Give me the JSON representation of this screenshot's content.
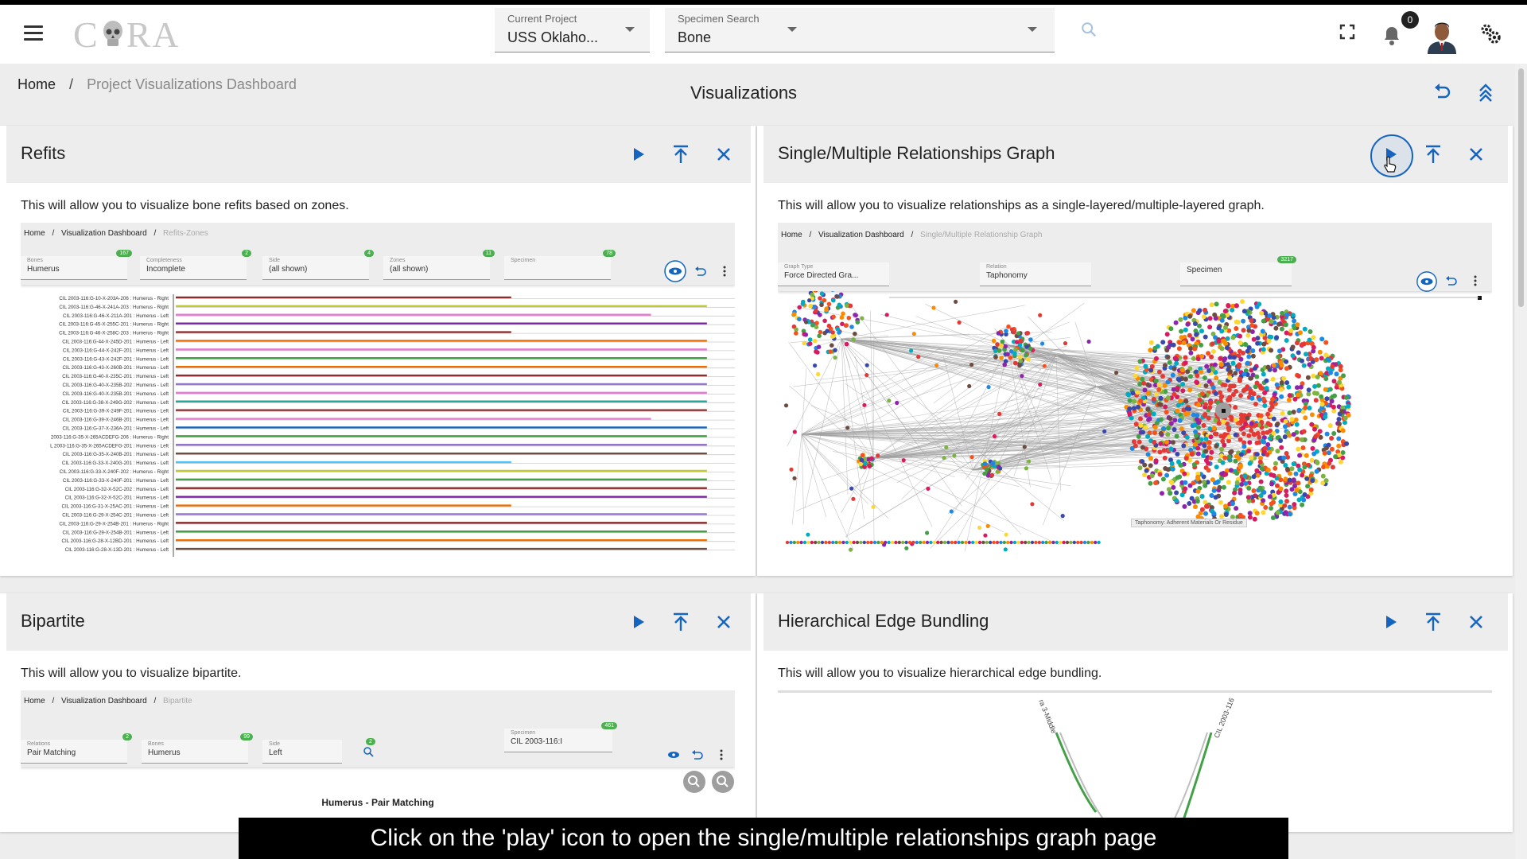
{
  "app": {
    "logo_text": "CORA",
    "current_project_label": "Current Project",
    "current_project_value": "USS Oklaho...",
    "specimen_search_label": "Specimen Search",
    "specimen_search_value": "Bone",
    "notifications_count": "0"
  },
  "breadcrumb": {
    "home": "Home",
    "separator": "/",
    "current": "Project Visualizations Dashboard"
  },
  "page_title": "Visualizations",
  "cards": {
    "refits": {
      "title": "Refits",
      "description": "This will allow you to visualize bone refits based on zones.",
      "preview": {
        "bc_home": "Home",
        "bc_sep": "/",
        "bc_dash": "Visualization Dashboard",
        "bc_current": "Refits-Zones",
        "fields": [
          {
            "label": "Bones",
            "value": "Humerus",
            "badge": "167"
          },
          {
            "label": "Completeness",
            "value": "Incomplete",
            "badge": "2"
          },
          {
            "label": "Side",
            "value": "(all shown)",
            "badge": "4"
          },
          {
            "label": "Zones",
            "value": "(all shown)",
            "badge": "11"
          },
          {
            "label": "Specimen",
            "value": "",
            "badge": "78"
          }
        ]
      }
    },
    "graph": {
      "title": "Single/Multiple Relationships Graph",
      "description": "This will allow you to visualize relationships as a single-layered/multiple-layered graph.",
      "preview": {
        "bc_home": "Home",
        "bc_sep": "/",
        "bc_dash": "Visualization Dashboard",
        "bc_current": "Single/Multiple Relationship Graph",
        "fields": [
          {
            "label": "Graph Type",
            "value": "Force Directed Gra...",
            "badge": ""
          },
          {
            "label": "Relation",
            "value": "Taphonomy",
            "badge": ""
          },
          {
            "label": "",
            "value": "Specimen",
            "badge": "3217"
          }
        ],
        "tooltip": "Taphonomy: Adherent Materials Or Residue"
      }
    },
    "bipartite": {
      "title": "Bipartite",
      "description": "This will allow you to visualize bipartite.",
      "preview": {
        "bc_home": "Home",
        "bc_sep": "/",
        "bc_dash": "Visualization Dashboard",
        "bc_current": "Bipartite",
        "fields": [
          {
            "label": "Relations",
            "value": "Pair Matching",
            "badge": "2"
          },
          {
            "label": "Bones",
            "value": "Humerus",
            "badge": "99"
          },
          {
            "label": "Side",
            "value": "Left",
            "badge": ""
          },
          {
            "label": "Specimen",
            "value": "CIL 2003-116:I",
            "badge": "461"
          }
        ],
        "filter_badge": "2",
        "chart_title": "Humerus - Pair Matching"
      }
    },
    "heb": {
      "title": "Hierarchical Edge Bundling",
      "description": "This will allow you to visualize hierarchical edge bundling.",
      "preview": {
        "label_left": "ra 3-Middle",
        "label_right": "CIL 2003-116"
      }
    }
  },
  "refit_rows": [
    "CIL 2003-116:G-10-X-203A-206 : Humerus - Right",
    "CIL 2003-116:G-46-X-241A-203 : Humerus - Right",
    "CIL 2003-116:G-46-X-211A-201 : Humerus - Left",
    "CIL 2003-116:G-45-X-255C-201 : Humerus - Right",
    "CIL 2003-116:G-46-X-258C-203 : Humerus - Right",
    "CIL 2003-116:G-44-X-245D-201 : Humerus - Left",
    "CIL 2003-116:G-44-X-242F-201 : Humerus - Left",
    "CIL 2003-116:G-43-X-242F-201 : Humerus - Left",
    "CIL 2003-116:G-43-X-260B-201 : Humerus - Left",
    "CIL 2003-116:G-40-X-235C-201 : Humerus - Left",
    "CIL 2003-116:G-40-X-235B-202 : Humerus - Left",
    "CIL 2003-116:G-40-X-235B-201 : Humerus - Left",
    "CIL 2003-116:G-38-X-249G-202 : Humerus - Left",
    "CIL 2003-116:G-39-X-249F-201 : Humerus - Left",
    "CIL 2003-116:G-39-X-246B-201 : Humerus - Left",
    "CIL 2003-116:G-37-X-236A-201 : Humerus - Left",
    "2003-116:G-35-X-265ACDEFG-206 : Humerus - Right",
    "L 2003-116:G-35-X-265ACDEFG-201 : Humerus - Left",
    "CIL 2003-116:G-35-X-240B-201 : Humerus - Left",
    "CIL 2003-116:G-33-X-240G-201 : Humerus - Left",
    "CIL 2003-116:G-33-X-240F-202 : Humerus - Right",
    "CIL 2003-116:G-33-X-240F-201 : Humerus - Left",
    "CIL 2003-116:G-32-X-52C-202 : Humerus - Left",
    "CIL 2003-116:G-32-X-52C-201 : Humerus - Left",
    "CIL 2003-116:G-31-X-25AC-201 : Humerus - Left",
    "CIL 2003-116:G-29-X-254C-201 : Humerus - Left",
    "CIL 2003-116:G-29-X-254B-201 : Humerus - Right",
    "CIL 2003-116:G-29-X-254B-201 : Humerus - Left",
    "CIL 2003-116:G-28-X-12BD-201 : Humerus - Left",
    "CIL 2003-116:G-28-X-13D-201 : Humerus - Left"
  ],
  "colors": {
    "accent": "#1565c0",
    "refit_lines": [
      "#8d2d2d",
      "#c0ca33",
      "#e57bcf",
      "#7b1fa2",
      "#8d2d2d",
      "#ef6c00",
      "#e57bcf",
      "#43a047",
      "#ef6c00",
      "#8d2d2d",
      "#9575cd",
      "#e57bcf",
      "#26a69a",
      "#8d2d2d",
      "#e57bcf",
      "#1565c0",
      "#43a047",
      "#9575cd",
      "#6d4c41",
      "#4fc3f7",
      "#c0ca33",
      "#43a047",
      "#8d2d2d",
      "#7b1fa2",
      "#ef6c00",
      "#9575cd",
      "#8d2d2d",
      "#43a047",
      "#ef6c00",
      "#6d4c41"
    ]
  },
  "caption": "Click on the 'play' icon to open the single/multiple relationships graph page"
}
